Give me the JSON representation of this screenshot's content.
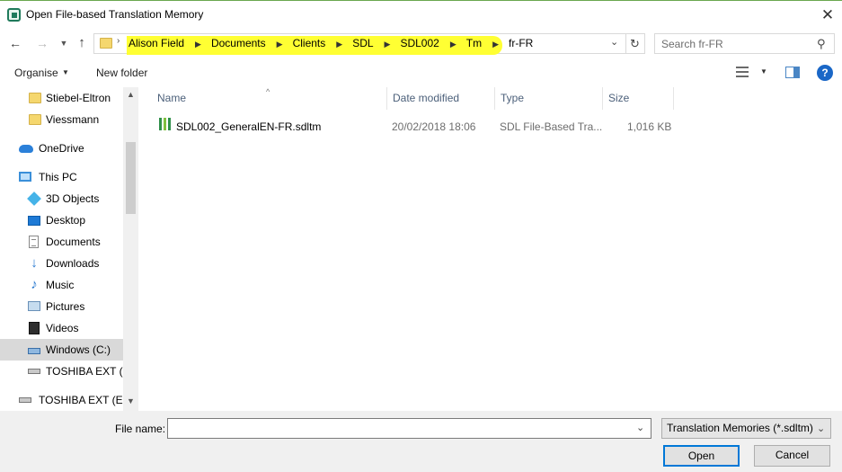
{
  "window": {
    "title": "Open File-based Translation Memory",
    "close_glyph": "✕"
  },
  "address": {
    "breadcrumbs": [
      "Alison Field",
      "Documents",
      "Clients",
      "SDL",
      "SDL002",
      "Tm",
      "fr-FR"
    ],
    "highlight_color": "#ffff33"
  },
  "search": {
    "placeholder": "Search fr-FR"
  },
  "toolbar": {
    "organise_label": "Organise",
    "new_folder_label": "New folder",
    "help_label": "?"
  },
  "nav": {
    "items": [
      {
        "label": "Stiebel-Eltron",
        "icon": "folder-icon"
      },
      {
        "label": "Viessmann",
        "icon": "folder-icon"
      },
      {
        "label": "OneDrive",
        "icon": "onedrive-cloud-icon"
      },
      {
        "label": "This PC",
        "icon": "computer-icon"
      },
      {
        "label": "3D Objects",
        "icon": "3d-objects-icon"
      },
      {
        "label": "Desktop",
        "icon": "desktop-icon"
      },
      {
        "label": "Documents",
        "icon": "documents-icon"
      },
      {
        "label": "Downloads",
        "icon": "downloads-icon"
      },
      {
        "label": "Music",
        "icon": "music-icon"
      },
      {
        "label": "Pictures",
        "icon": "pictures-icon"
      },
      {
        "label": "Videos",
        "icon": "videos-icon"
      },
      {
        "label": "Windows (C:)",
        "icon": "windows-drive-icon",
        "selected": true
      },
      {
        "label": "TOSHIBA EXT (E:)",
        "icon": "drive-icon"
      },
      {
        "label": "TOSHIBA EXT (E:)",
        "icon": "drive-icon"
      }
    ]
  },
  "files": {
    "columns": [
      "Name",
      "Date modified",
      "Type",
      "Size"
    ],
    "rows": [
      {
        "name": "SDL002_GeneralEN-FR.sdltm",
        "date_modified": "20/02/2018 18:06",
        "type": "SDL File-Based Tra...",
        "size": "1,016 KB",
        "icon": "sdltm-file-icon"
      }
    ]
  },
  "footer": {
    "filename_label": "File name:",
    "filename_value": "",
    "filetype_value": "Translation Memories (*.sdltm)",
    "open_label": "Open",
    "cancel_label": "Cancel"
  },
  "colors": {
    "accent": "#0078d7",
    "column_header_text": "#4c607a",
    "selected_nav_bg": "#d9d9d9"
  }
}
